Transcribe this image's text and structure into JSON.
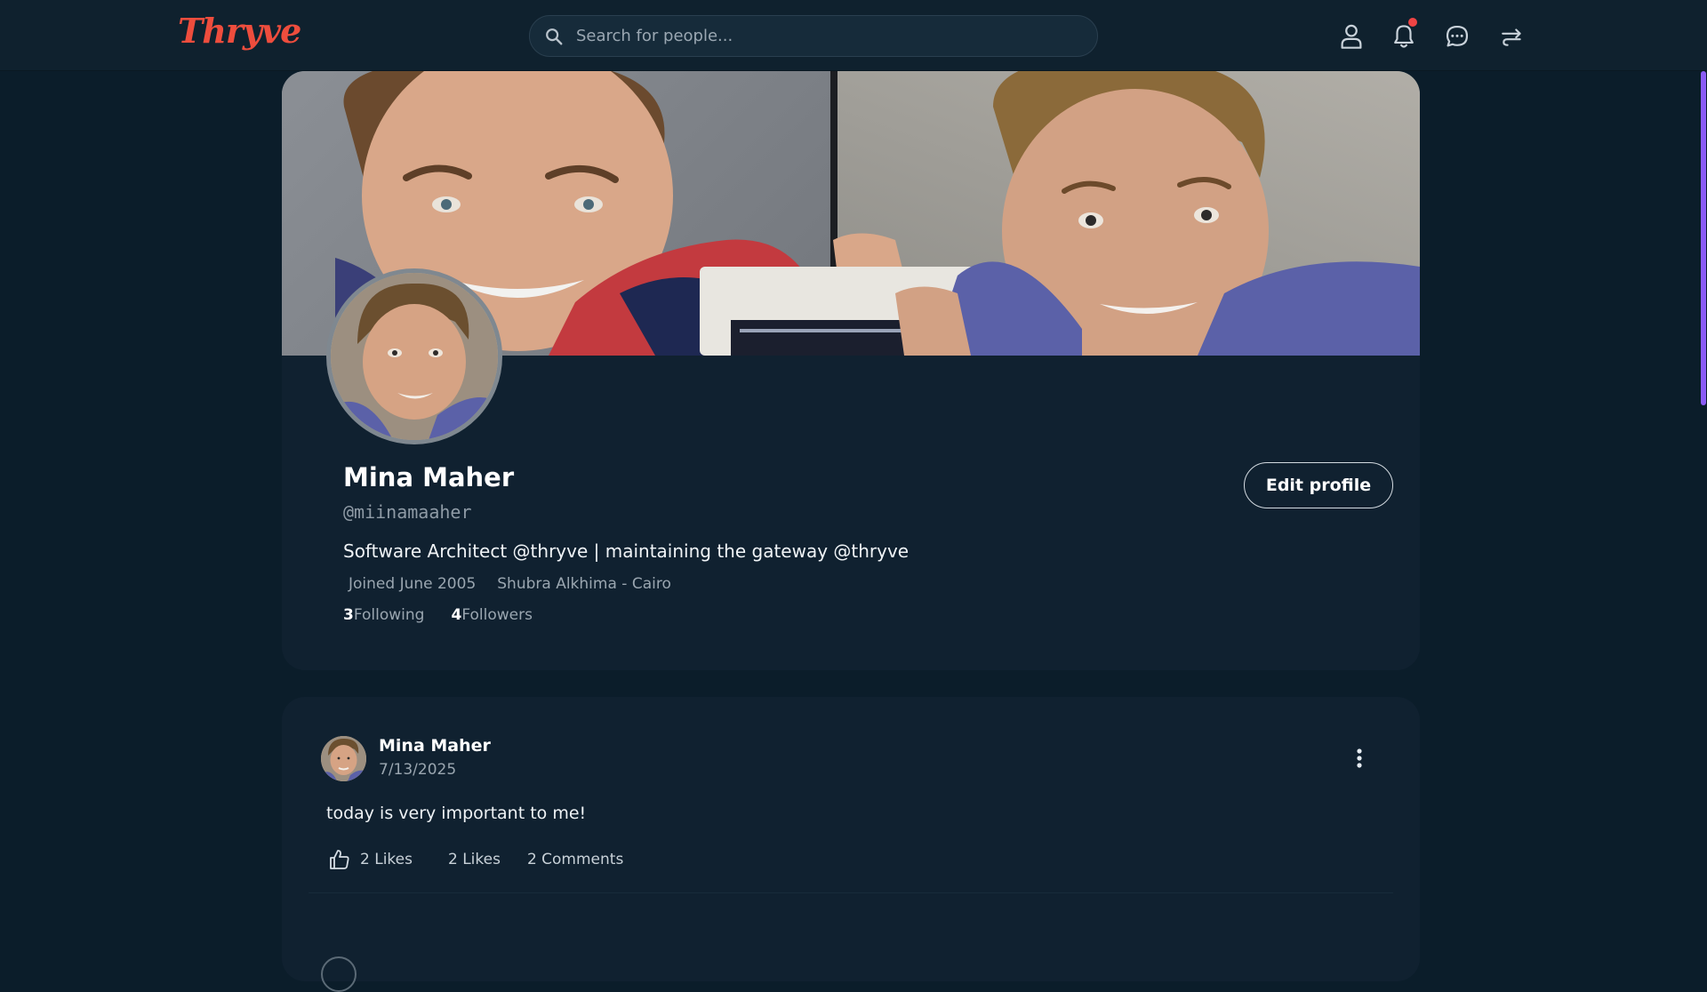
{
  "app": {
    "logo_text": "Thryve",
    "brand_color": "#ee4d3d",
    "accent_color": "#8b5cf6"
  },
  "nav": {
    "search_placeholder": "Search for people...",
    "icons": [
      "user-icon",
      "bell-icon",
      "chat-icon",
      "logout-icon"
    ],
    "has_unread_notifications": true,
    "notification_dot_color": "#ef4444"
  },
  "profile": {
    "name": "Mina Maher",
    "handle": "@miinamaaher",
    "bio": "Software Architect @thryve | maintaining the gateway @thryve",
    "joined": "Joined June 2005",
    "location": "Shubra Alkhima - Cairo",
    "following_count": "3",
    "following_label": "Following",
    "followers_count": "4",
    "followers_label": "Followers",
    "edit_button_label": "Edit profile"
  },
  "posts": [
    {
      "author": "Mina Maher",
      "date": "7/13/2025",
      "text": "today is very important to me!",
      "like_button_label": "2 Likes",
      "likes_label": "2 Likes",
      "comments_label": "2 Comments"
    }
  ]
}
